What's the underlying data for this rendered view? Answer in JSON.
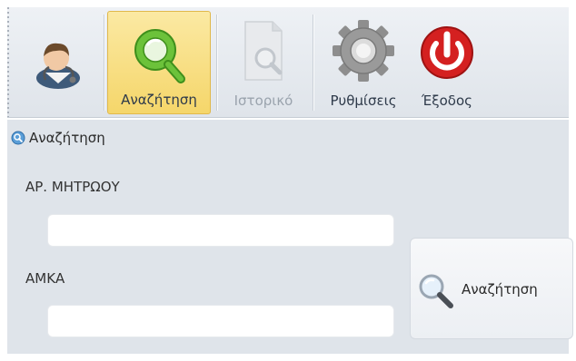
{
  "toolbar": {
    "buttons": [
      {
        "label": "",
        "icon": "doctor-avatar-icon"
      },
      {
        "label": "Αναζήτηση",
        "icon": "search-icon",
        "state": "active"
      },
      {
        "label": "Ιστορικό",
        "icon": "history-icon",
        "state": "disabled"
      },
      {
        "label": "Ρυθμίσεις",
        "icon": "gear-icon"
      },
      {
        "label": "Έξοδος",
        "icon": "power-icon"
      }
    ]
  },
  "panel": {
    "title": "Αναζήτηση",
    "title_icon": "search-icon",
    "fields": [
      {
        "label": "ΑΡ. ΜΗΤΡΩΟΥ",
        "value": "",
        "placeholder": ""
      },
      {
        "label": "ΑΜΚΑ",
        "value": "",
        "placeholder": ""
      }
    ],
    "search_button": {
      "label": "Αναζήτηση",
      "icon": "magnifier-icon"
    }
  },
  "colors": {
    "active_highlight": "#f5d66a",
    "panel_background": "#dfe4ea",
    "search_green": "#5cb82c",
    "power_red": "#d42020",
    "gear_gray": "#8e8e8e"
  }
}
